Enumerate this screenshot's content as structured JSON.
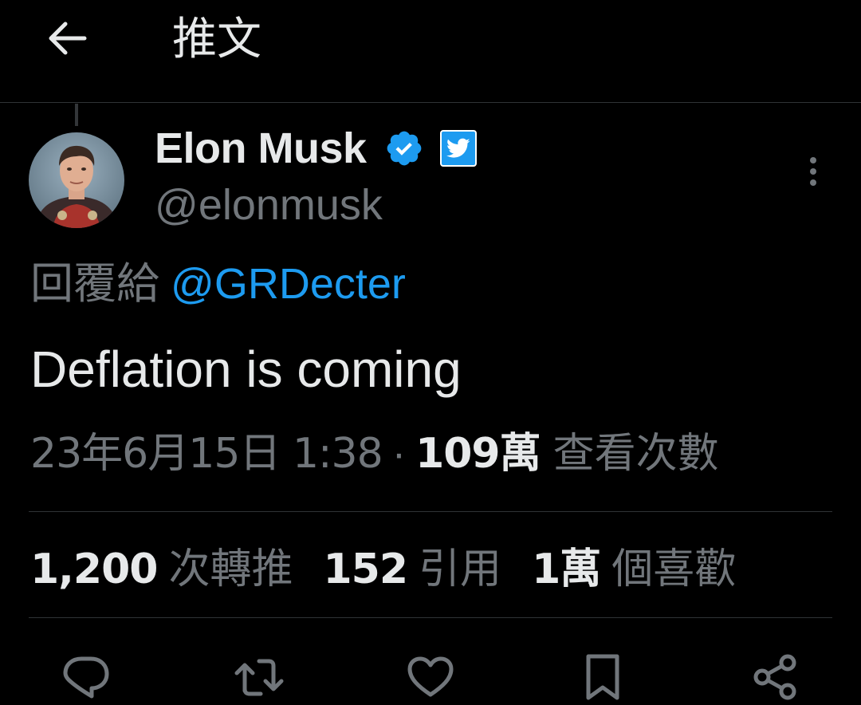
{
  "header": {
    "title": "推文",
    "back_icon": "arrow-left-icon"
  },
  "tweet": {
    "author": {
      "display_name": "Elon Musk",
      "handle": "@elonmusk",
      "verified_icon": "verified-badge-icon",
      "affiliation_icon": "twitter-bird-icon"
    },
    "reply_prefix": "回覆給",
    "reply_to": "@GRDecter",
    "text": "Deflation is coming",
    "timestamp": "23年6月15日 1:38",
    "separator": "·",
    "views_count": "109萬",
    "views_label": "查看次數"
  },
  "stats": [
    {
      "count": "1,200",
      "label": "次轉推"
    },
    {
      "count": "152",
      "label": "引用"
    },
    {
      "count": "1萬",
      "label": "個喜歡"
    }
  ],
  "actions": {
    "reply_icon": "reply-bubble-icon",
    "retweet_icon": "retweet-icon",
    "like_icon": "heart-icon",
    "bookmark_icon": "bookmark-icon",
    "share_icon": "share-icon"
  },
  "colors": {
    "background": "#000000",
    "text_primary": "#e7e9ea",
    "text_secondary": "#71767b",
    "accent": "#1d9bf0",
    "divider": "#2f3336"
  }
}
